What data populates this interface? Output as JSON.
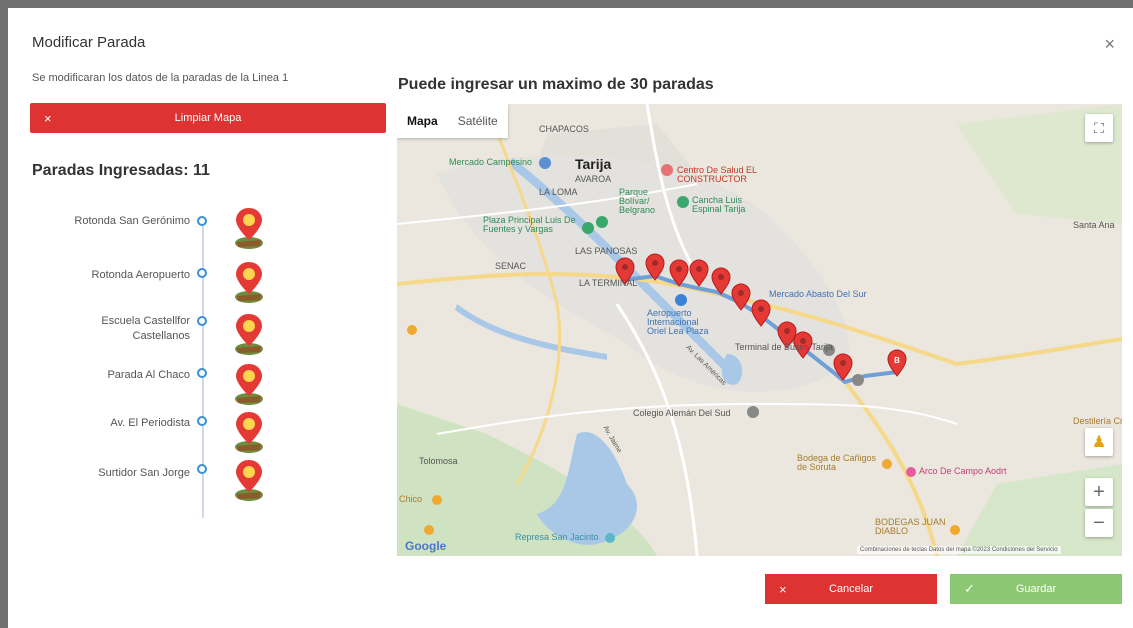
{
  "modal": {
    "title": "Modificar Parada",
    "close_icon": "×",
    "subtitle": "Se modificaran los datos de la paradas de la Linea 1"
  },
  "clear_button": {
    "icon": "×",
    "label": "Limpiar Mapa"
  },
  "stops_section": {
    "title": "Paradas Ingresadas: 11",
    "stops": [
      {
        "label": "Rotonda San Gerónimo"
      },
      {
        "label": "Rotonda Aeropuerto"
      },
      {
        "label": "Escuela Castellfor Castellanos"
      },
      {
        "label": "Parada Al Chaco"
      },
      {
        "label": "Av. El Periodista"
      },
      {
        "label": "Surtidor San Jorge"
      }
    ]
  },
  "map": {
    "heading": "Puede ingresar un maximo de 30 paradas",
    "tabs": [
      "Mapa",
      "Satélite"
    ],
    "labels": {
      "chapacos": "CHAPACOS",
      "mercado_campesino": "Mercado Campesino",
      "tarija": "Tarija",
      "avaroa": "AVAROA",
      "la_loma": "LA LOMA",
      "parque": "Parque Bolívar/ Belgrano",
      "centro_salud": "Centro De Salud EL CONSTRUCTOR",
      "cancha": "Cancha Luis Espinal Tarija",
      "plaza": "Plaza Principal Luis De Fuentes y Vargas",
      "las_panosas": "LAS PANOSAS",
      "senac": "SENAC",
      "la_terminal": "LA TERMINAL",
      "mercado_abasto": "Mercado Abasto Del Sur",
      "aeropuerto": "Aeropuerto Internacional Oriel Lea Plaza",
      "terminal_buses": "Terminal de Buses Tarija",
      "santa_ana": "Santa Ana",
      "colegio": "Colegio Alemán Del Sud",
      "tolomosa": "Tolomosa",
      "bodega": "Bodega de Cañigos de Soruta",
      "arco": "Arco De Campo Aodrt",
      "destileria": "Destilería Cruz",
      "represa": "Represa San Jacinto",
      "bodegas_juan": "BODEGAS JUAN DIABLO",
      "chico": "Chico",
      "av_jaime": "Av. Jaime",
      "av_las_americas": "Av. Las Américas"
    },
    "footer": "Combinaciones de teclas   Datos del mapa ©2023   Condiciones del Servicio",
    "google": "Google",
    "zoom_in": "+",
    "zoom_out": "−",
    "fullscreen_icon": "⛶",
    "pegman_icon": "♟",
    "route_color": "#6f9fd8",
    "marker_color": "#e53935"
  },
  "actions": {
    "cancel_icon": "×",
    "cancel_label": "Cancelar",
    "save_icon": "✓",
    "save_label": "Guardar"
  }
}
